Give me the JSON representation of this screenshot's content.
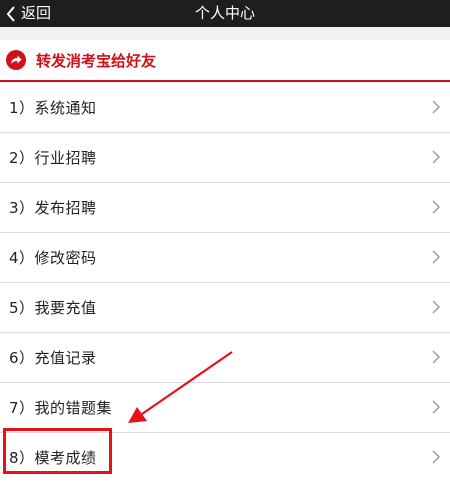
{
  "header": {
    "back_label": "返回",
    "title": "个人中心"
  },
  "share": {
    "label": "转发消考宝给好友",
    "icon": "share-icon",
    "color": "#d0111b"
  },
  "menu": {
    "items": [
      {
        "label": "1）系统通知"
      },
      {
        "label": "2）行业招聘"
      },
      {
        "label": "3）发布招聘"
      },
      {
        "label": "4）修改密码"
      },
      {
        "label": "5）我要充值"
      },
      {
        "label": "6）充值记录"
      },
      {
        "label": "7）我的错题集"
      },
      {
        "label": "8）模考成绩"
      }
    ]
  },
  "annotation": {
    "color": "#e8111b",
    "highlighted_item": "8）模考成绩"
  }
}
